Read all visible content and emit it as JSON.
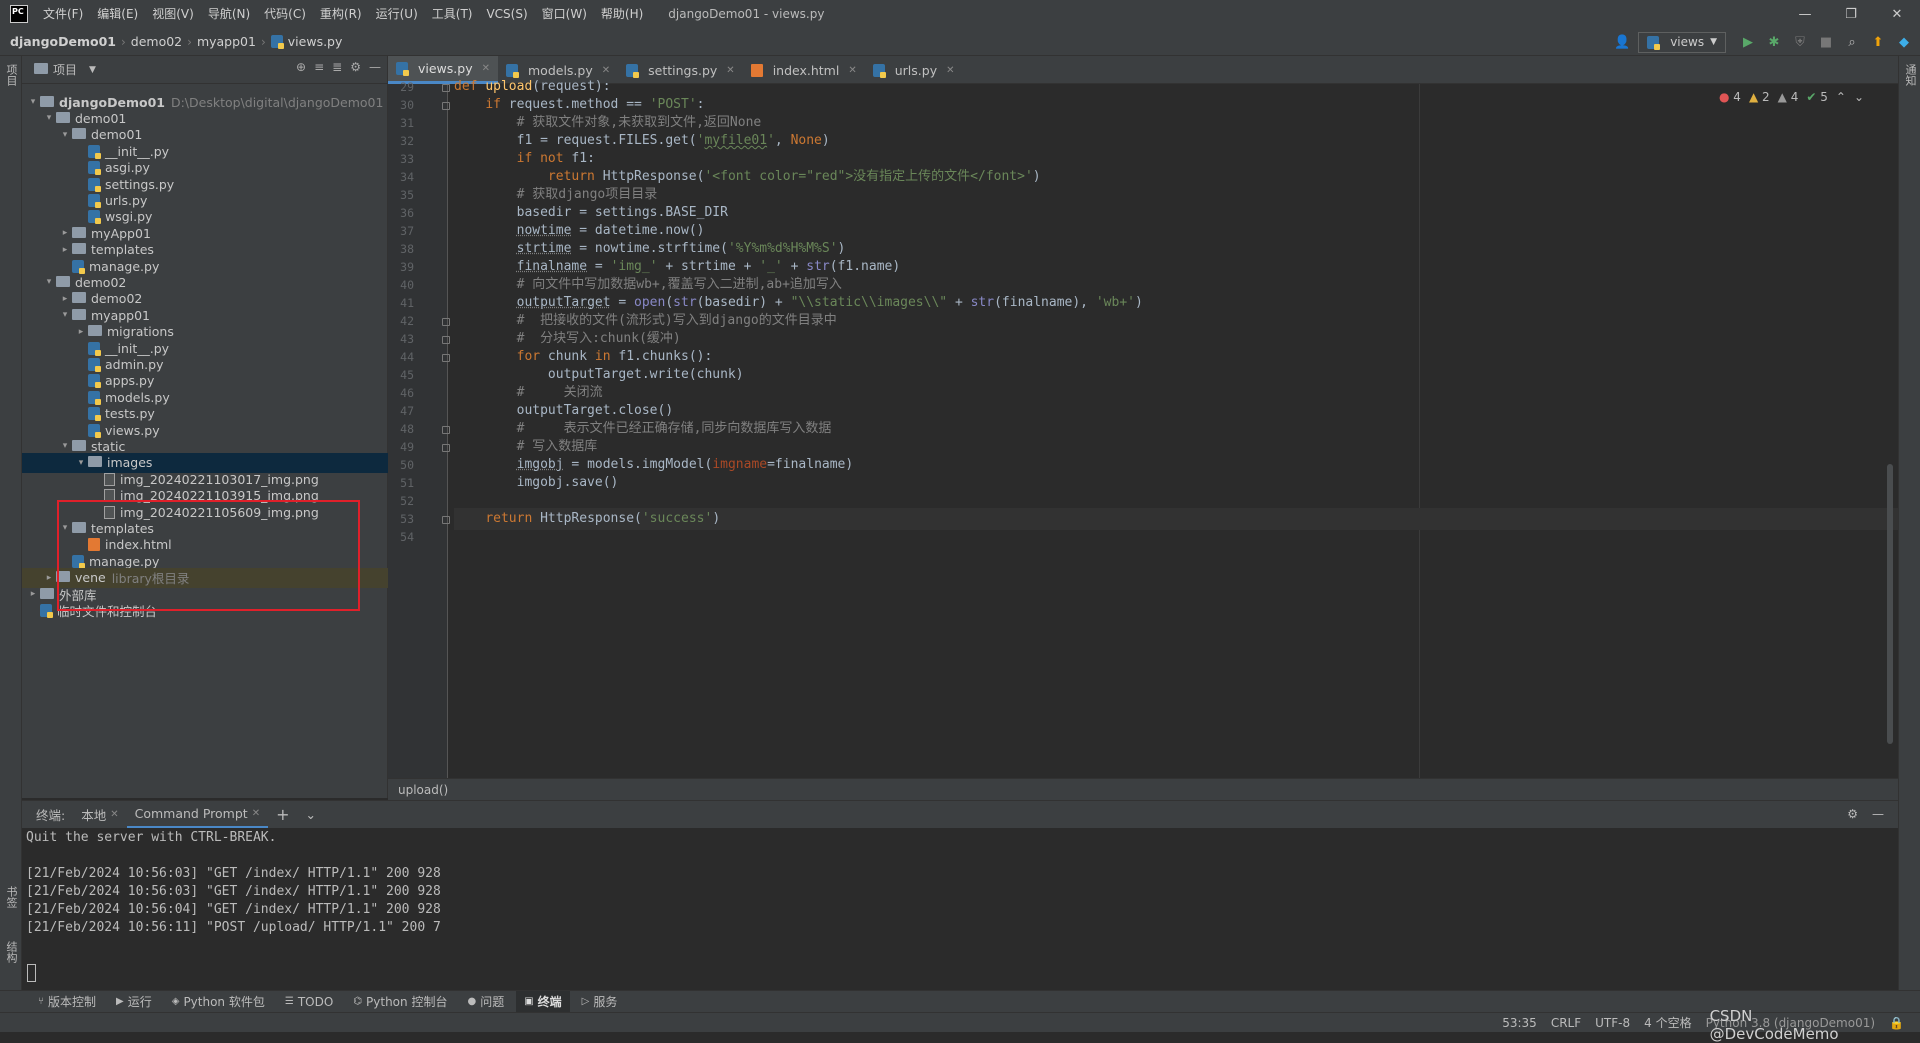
{
  "app": {
    "logo": "PC",
    "window_title": "djangoDemo01 - views.py"
  },
  "menu": [
    "文件(F)",
    "编辑(E)",
    "视图(V)",
    "导航(N)",
    "代码(C)",
    "重构(R)",
    "运行(U)",
    "工具(T)",
    "VCS(S)",
    "窗口(W)",
    "帮助(H)"
  ],
  "breadcrumbs": [
    "djangoDemo01",
    "demo02",
    "myapp01",
    "views.py"
  ],
  "run_config": "views",
  "project_panel": {
    "title": "项目"
  },
  "tree": [
    {
      "depth": 0,
      "arrow": "▾",
      "type": "folder",
      "label": "djangoDemo01",
      "extra": "D:\\Desktop\\digital\\djangoDemo01",
      "bold": true
    },
    {
      "depth": 1,
      "arrow": "▾",
      "type": "folder",
      "label": "demo01"
    },
    {
      "depth": 2,
      "arrow": "▾",
      "type": "folder",
      "label": "demo01"
    },
    {
      "depth": 3,
      "arrow": "",
      "type": "py",
      "label": "__init__.py"
    },
    {
      "depth": 3,
      "arrow": "",
      "type": "py",
      "label": "asgi.py"
    },
    {
      "depth": 3,
      "arrow": "",
      "type": "py",
      "label": "settings.py"
    },
    {
      "depth": 3,
      "arrow": "",
      "type": "py",
      "label": "urls.py"
    },
    {
      "depth": 3,
      "arrow": "",
      "type": "py",
      "label": "wsgi.py"
    },
    {
      "depth": 2,
      "arrow": "▸",
      "type": "folder",
      "label": "myApp01"
    },
    {
      "depth": 2,
      "arrow": "▸",
      "type": "folder",
      "label": "templates"
    },
    {
      "depth": 2,
      "arrow": "",
      "type": "py",
      "label": "manage.py"
    },
    {
      "depth": 1,
      "arrow": "▾",
      "type": "folder",
      "label": "demo02"
    },
    {
      "depth": 2,
      "arrow": "▸",
      "type": "folder",
      "label": "demo02"
    },
    {
      "depth": 2,
      "arrow": "▾",
      "type": "folder",
      "label": "myapp01"
    },
    {
      "depth": 3,
      "arrow": "▸",
      "type": "folder",
      "label": "migrations"
    },
    {
      "depth": 3,
      "arrow": "",
      "type": "py",
      "label": "__init__.py"
    },
    {
      "depth": 3,
      "arrow": "",
      "type": "py",
      "label": "admin.py"
    },
    {
      "depth": 3,
      "arrow": "",
      "type": "py",
      "label": "apps.py"
    },
    {
      "depth": 3,
      "arrow": "",
      "type": "py",
      "label": "models.py"
    },
    {
      "depth": 3,
      "arrow": "",
      "type": "py",
      "label": "tests.py"
    },
    {
      "depth": 3,
      "arrow": "",
      "type": "py",
      "label": "views.py"
    },
    {
      "depth": 2,
      "arrow": "▾",
      "type": "folder",
      "label": "static"
    },
    {
      "depth": 3,
      "arrow": "▾",
      "type": "folder",
      "label": "images",
      "selected": true
    },
    {
      "depth": 4,
      "arrow": "",
      "type": "img",
      "label": "img_20240221103017_img.png"
    },
    {
      "depth": 4,
      "arrow": "",
      "type": "img",
      "label": "img_20240221103915_img.png"
    },
    {
      "depth": 4,
      "arrow": "",
      "type": "img",
      "label": "img_20240221105609_img.png"
    },
    {
      "depth": 2,
      "arrow": "▾",
      "type": "folder",
      "label": "templates"
    },
    {
      "depth": 3,
      "arrow": "",
      "type": "html",
      "label": "index.html"
    },
    {
      "depth": 2,
      "arrow": "",
      "type": "py",
      "label": "manage.py"
    },
    {
      "depth": 1,
      "arrow": "▸",
      "type": "folder",
      "label": "vene",
      "extra": "library根目录",
      "lib": true
    },
    {
      "depth": 0,
      "arrow": "▸",
      "type": "lib",
      "label": "外部库"
    },
    {
      "depth": 0,
      "arrow": "",
      "type": "scratch",
      "label": "临时文件和控制台"
    }
  ],
  "tabs": [
    {
      "label": "views.py",
      "active": true
    },
    {
      "label": "models.py"
    },
    {
      "label": "settings.py"
    },
    {
      "label": "index.html",
      "html": true
    },
    {
      "label": "urls.py"
    }
  ],
  "inspections": {
    "errors": "4",
    "warnings": "2",
    "weak": "4",
    "ok": "5"
  },
  "code_lines": [
    {
      "n": 29,
      "html": "<span class=\"kw\">def</span> <span class=\"fn\">upload</span>(request):"
    },
    {
      "n": 30,
      "html": "    <span class=\"kw\">if</span> request.method == <span class=\"str\">'POST'</span>:"
    },
    {
      "n": 31,
      "html": "        <span class=\"cm\"># 获取文件对象,未获取到文件,返回None</span>"
    },
    {
      "n": 32,
      "html": "        f1 = request.FILES.get(<span class=\"str\">'<span class=\"ul\">myfile01</span>'</span>, <span class=\"kw\">None</span>)"
    },
    {
      "n": 33,
      "html": "        <span class=\"kw\">if not</span> f1:"
    },
    {
      "n": 34,
      "html": "            <span class=\"kw\">return</span> HttpResponse(<span class=\"str\">'&lt;font color=\"red\"&gt;没有指定上传的文件&lt;/font&gt;'</span>)"
    },
    {
      "n": 35,
      "html": "        <span class=\"cm\"># 获取django项目目录</span>"
    },
    {
      "n": 36,
      "html": "        basedir = settings.BASE_DIR"
    },
    {
      "n": 37,
      "html": "        <span class=\"dots\">nowtime</span> = datetime.now()"
    },
    {
      "n": 38,
      "html": "        <span class=\"dots\">strtime</span> = nowtime.strftime(<span class=\"str\">'%Y%m%d%H%M%S'</span>)"
    },
    {
      "n": 39,
      "html": "        <span class=\"dots\">finalname</span> = <span class=\"str\">'img_'</span> + strtime + <span class=\"str\">'_'</span> + <span class=\"bi\">str</span>(f1.name)"
    },
    {
      "n": 40,
      "html": "        <span class=\"cm\"># 向文件中写加数据wb+,覆盖写入二进制,ab+追加写入</span>"
    },
    {
      "n": 41,
      "html": "        <span class=\"dots\">outputTarget</span> = <span class=\"bi\">open</span>(<span class=\"bi\">str</span>(basedir) + <span class=\"str\">\"\\\\static\\\\images\\\\\"</span> + <span class=\"bi\">str</span>(finalname), <span class=\"str\">'wb+'</span>)"
    },
    {
      "n": 42,
      "html": "        <span class=\"cm\">#  把接收的文件(流形式)写入到django的文件目录中</span>"
    },
    {
      "n": 43,
      "html": "        <span class=\"cm\">#  分块写入:chunk(缓冲)</span>"
    },
    {
      "n": 44,
      "html": "        <span class=\"kw\">for</span> chunk <span class=\"kw\">in</span> f1.chunks():"
    },
    {
      "n": 45,
      "html": "            outputTarget.write(chunk)"
    },
    {
      "n": 46,
      "html": "        <span class=\"cm\">#     关闭流</span>"
    },
    {
      "n": 47,
      "html": "        outputTarget.close()"
    },
    {
      "n": 48,
      "html": "        <span class=\"cm\">#     表示文件已经正确存储,同步向数据库写入数据</span>"
    },
    {
      "n": 49,
      "html": "        <span class=\"cm\"># 写入数据库</span>"
    },
    {
      "n": 50,
      "html": "        <span class=\"dots\">imgobj</span> = models.imgModel(<span class=\"prm\">imgname</span>=finalname)"
    },
    {
      "n": 51,
      "html": "        imgobj.save()"
    },
    {
      "n": 52,
      "html": ""
    },
    {
      "n": 53,
      "html": "    <span class=\"kw\">return</span> HttpResponse(<span class=\"str\">'success'</span>)",
      "current": true
    },
    {
      "n": 54,
      "html": ""
    }
  ],
  "code_breadcrumb": "upload()",
  "terminal": {
    "label": "终端:",
    "tabs": [
      "本地",
      "Command Prompt"
    ],
    "lines": [
      "Quit the server with CTRL-BREAK.",
      "",
      "[21/Feb/2024 10:56:03] \"GET /index/ HTTP/1.1\" 200 928",
      "[21/Feb/2024 10:56:03] \"GET /index/ HTTP/1.1\" 200 928",
      "[21/Feb/2024 10:56:04] \"GET /index/ HTTP/1.1\" 200 928",
      "[21/Feb/2024 10:56:11] \"POST /upload/ HTTP/1.1\" 200 7"
    ]
  },
  "bottom_tools": [
    "版本控制",
    "运行",
    "Python 软件包",
    "TODO",
    "Python 控制台",
    "问题",
    "终端",
    "服务"
  ],
  "bottom_active": "终端",
  "status": {
    "position": "53:35",
    "line_sep": "CRLF",
    "encoding": "UTF-8",
    "indent": "4 个空格",
    "interpreter": "Python 3.8 (djangoDemo01)",
    "watermark": "CSDN @DevCodeMemo"
  },
  "left_strip": [
    "项目",
    "书签",
    "结构"
  ],
  "right_strip": [
    "通知"
  ]
}
